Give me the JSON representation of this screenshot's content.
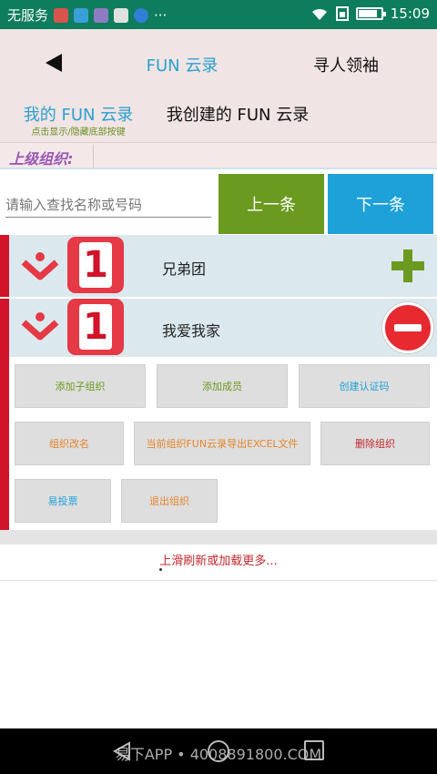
{
  "status_bar": {
    "carrier": "无服务",
    "dots": "···",
    "time": "15:09",
    "battery_level": 0.85
  },
  "header": {
    "back_icon": "back-arrow-icon",
    "title": "FUN 云录",
    "right_action": "寻人领袖",
    "tab_mine": "我的 FUN 云录",
    "tab_mine_sub": "点击显示/隐藏底部按键",
    "tab_created": "我创建的 FUN 云录"
  },
  "parent_org": {
    "label": "上级组织:"
  },
  "search": {
    "placeholder": "请输入查找名称或号码",
    "prev_label": "上一条",
    "next_label": "下一条"
  },
  "orgs": [
    {
      "badge": "1",
      "name": "兄弟团",
      "action_icon": "plus-icon"
    },
    {
      "badge": "1",
      "name": "我爱我家",
      "action_icon": "minus-icon"
    }
  ],
  "actions": {
    "add_suborg": "添加子组织",
    "add_member": "添加成员",
    "create_code": "创建认证码",
    "rename_org": "组织改名",
    "export_excel": "当前组织FUN云录导出EXCEL文件",
    "delete_org": "删除组织",
    "easy_vote": "易投票",
    "exit_org": "退出组织"
  },
  "load_more": "上滑刷新或加载更多...",
  "watermark": "易下APP • 4008891800.COM",
  "colors": {
    "status_bar": "#0e7d5d",
    "accent_blue": "#1ea1d8",
    "accent_green": "#6a9a1f",
    "accent_red": "#d2142b",
    "accent_orange": "#e6842a",
    "accent_purple": "#9b59b6"
  }
}
